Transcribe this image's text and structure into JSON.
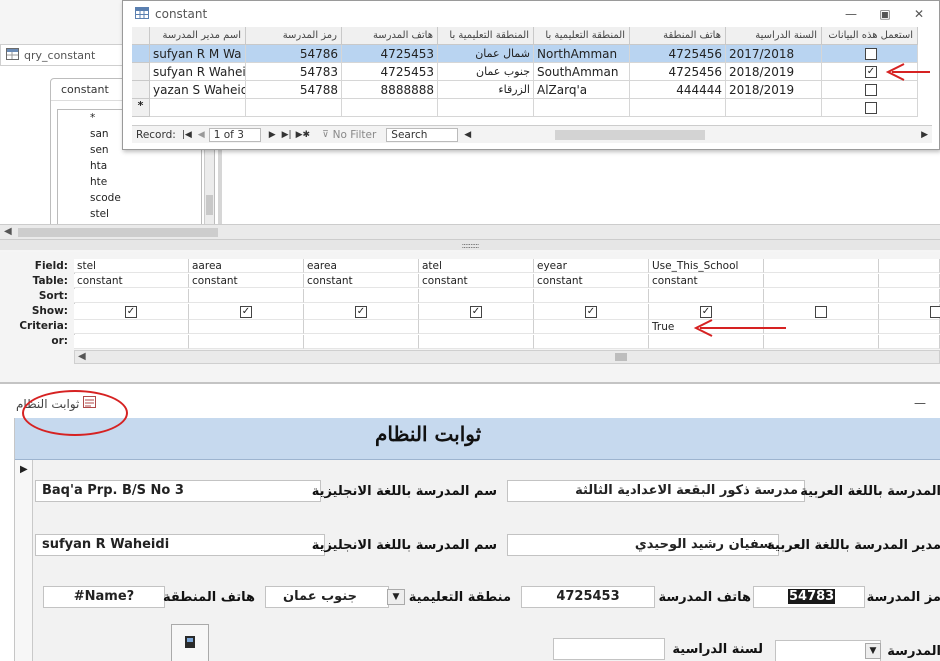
{
  "designer": {
    "tab_title": "qry_constant",
    "field_list": {
      "title": "constant",
      "items": [
        "*",
        "san",
        "sen",
        "hta",
        "hte",
        "scode",
        "stel"
      ]
    },
    "grid": {
      "row_labels": {
        "field": "Field:",
        "table": "Table:",
        "sort": "Sort:",
        "show": "Show:",
        "criteria": "Criteria:",
        "or": "or:"
      },
      "columns": [
        {
          "field": "stel",
          "table": "constant",
          "show": true,
          "criteria": ""
        },
        {
          "field": "aarea",
          "table": "constant",
          "show": true,
          "criteria": ""
        },
        {
          "field": "earea",
          "table": "constant",
          "show": true,
          "criteria": ""
        },
        {
          "field": "atel",
          "table": "constant",
          "show": true,
          "criteria": ""
        },
        {
          "field": "eyear",
          "table": "constant",
          "show": true,
          "criteria": ""
        },
        {
          "field": "Use_This_School",
          "table": "constant",
          "show": true,
          "criteria": "True"
        },
        {
          "field": "",
          "table": "",
          "show": false,
          "criteria": ""
        },
        {
          "field": "",
          "table": "",
          "show": false,
          "criteria": ""
        }
      ]
    }
  },
  "datasheet": {
    "title": "constant",
    "headers": [
      "اسم مدير المدرسة",
      "رمز المدرسة",
      "هاتف المدرسة",
      "المنطقة التعليمية با",
      "المنطقة التعليمية با",
      "هاتف المنطقة",
      "السنة الدراسية",
      "استعمل هذه البيانات"
    ],
    "rows": [
      {
        "manager": "sufyan R M Wa",
        "code": "54786",
        "phone": "4725453",
        "area_ar": "شمال عمان",
        "area_en": "NorthAmman",
        "area_phone": "4725456",
        "year": "2017/2018",
        "use": false
      },
      {
        "manager": "sufyan R Wahei",
        "code": "54783",
        "phone": "4725453",
        "area_ar": "جنوب عمان",
        "area_en": "SouthAmman",
        "area_phone": "4725456",
        "year": "2018/2019",
        "use": true
      },
      {
        "manager": "yazan S Waheid",
        "code": "54788",
        "phone": "8888888",
        "area_ar": "الزرقاء",
        "area_en": "AlZarq'a",
        "area_phone": "444444",
        "year": "2018/2019",
        "use": false
      }
    ],
    "new_row_marker": "*",
    "nav": {
      "record_label": "Record:",
      "position": "1 of 3",
      "no_filter": "No Filter",
      "search": "Search"
    }
  },
  "form": {
    "tab_title": "ثوابت النظام",
    "header_title": "ثوابت النظام",
    "fields": {
      "school_name_en_value": "Baq'a Prp. B/S No 3",
      "school_name_en_label": "سم المدرسة باللغة الانجليزية",
      "school_name_ar_value": "مدرسة ذكور البقعة الاعدادية الثالثة",
      "school_name_ar_label": "المدرسة باللغة العربية",
      "manager_en_value": "sufyan R Waheidi",
      "manager_en_label": "سم المدرسة باللغة الانجليزية",
      "manager_ar_value": "سفيان رشيد الوحيدي",
      "manager_ar_label": "مدير المدرسة باللغة العربية",
      "area_phone_value": "#Name?",
      "area_phone_label": "هاتف المنطقة",
      "area_value": "جنوب عمان",
      "area_label": "منطقة التعليمية",
      "school_phone_value": "4725453",
      "school_phone_label": "هاتف المدرسة",
      "school_code_value": "54783",
      "school_code_label": "مز المدرسة",
      "year_label": "لسنة الدراسية",
      "year_value": "",
      "last_label": "المدرسة",
      "last_value": ""
    }
  },
  "colors": {
    "selection": "#b9d4f1",
    "form_header": "#c6d9ee",
    "annotation": "#d62222"
  }
}
